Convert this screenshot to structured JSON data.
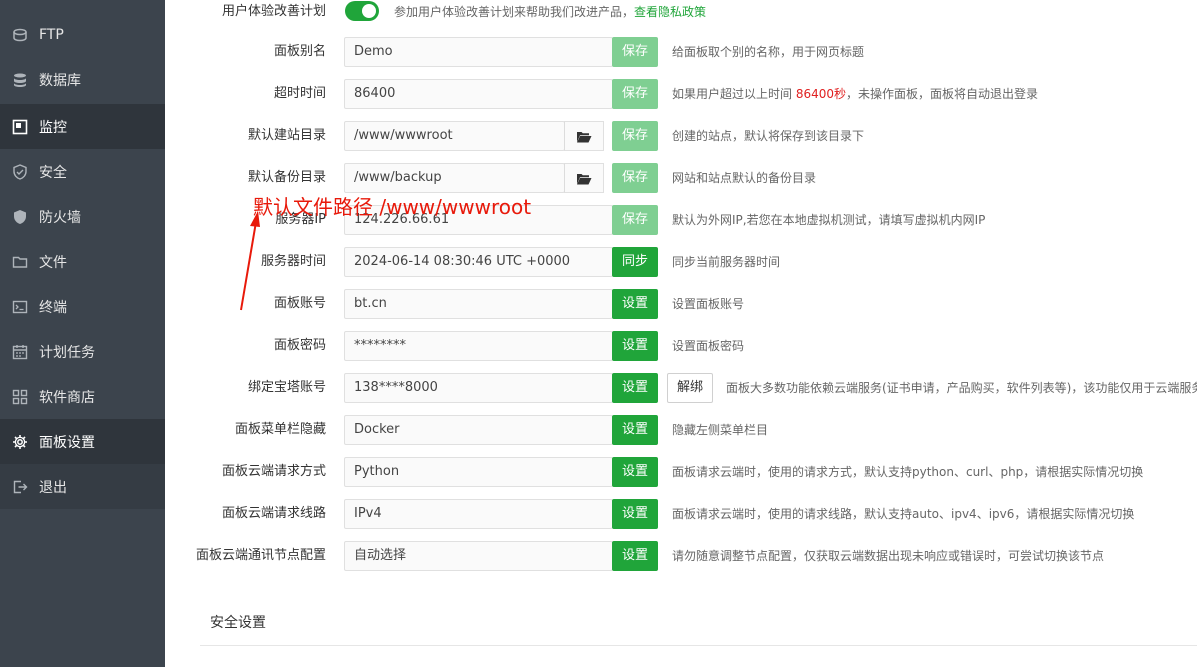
{
  "sidebar": {
    "items": [
      {
        "label": "FTP",
        "icon": "ftp-icon"
      },
      {
        "label": "数据库",
        "icon": "database-icon"
      },
      {
        "label": "监控",
        "icon": "monitor-icon"
      },
      {
        "label": "安全",
        "icon": "shield-check-icon"
      },
      {
        "label": "防火墙",
        "icon": "shield-icon"
      },
      {
        "label": "文件",
        "icon": "folder-icon"
      },
      {
        "label": "终端",
        "icon": "terminal-icon"
      },
      {
        "label": "计划任务",
        "icon": "calendar-icon"
      },
      {
        "label": "软件商店",
        "icon": "grid-icon"
      },
      {
        "label": "面板设置",
        "icon": "gear-icon"
      },
      {
        "label": "退出",
        "icon": "logout-icon"
      }
    ]
  },
  "settings": {
    "ux_plan": {
      "label": "用户体验改善计划",
      "hint": "参加用户体验改善计划来帮助我们改进产品，",
      "link": "查看隐私政策",
      "enabled": true
    },
    "alias": {
      "label": "面板别名",
      "value": "Demo",
      "button": "保存",
      "hint": "给面板取个别的名称，用于网页标题"
    },
    "timeout": {
      "label": "超时时间",
      "value": "86400",
      "button": "保存",
      "hint_before": "如果用户超过以上时间 ",
      "hint_red": "86400秒",
      "hint_after": "，未操作面板，面板将自动退出登录"
    },
    "site_dir": {
      "label": "默认建站目录",
      "value": "/www/wwwroot",
      "button": "保存",
      "hint": "创建的站点，默认将保存到该目录下"
    },
    "backup_dir": {
      "label": "默认备份目录",
      "value": "/www/backup",
      "button": "保存",
      "hint": "网站和站点默认的备份目录"
    },
    "server_ip": {
      "label": "服务器IP",
      "value": "124.226.66.61",
      "button": "保存",
      "hint": "默认为外网IP,若您在本地虚拟机测试，请填写虚拟机内网IP"
    },
    "server_time": {
      "label": "服务器时间",
      "value": "2024-06-14 08:30:46 UTC +0000",
      "button": "同步",
      "hint": "同步当前服务器时间"
    },
    "account": {
      "label": "面板账号",
      "value": "bt.cn",
      "button": "设置",
      "hint": "设置面板账号"
    },
    "password": {
      "label": "面板密码",
      "value": "********",
      "button": "设置",
      "hint": "设置面板密码"
    },
    "bt_account": {
      "label": "绑定宝塔账号",
      "value": "138****8000",
      "button": "设置",
      "button2": "解绑",
      "hint": "面板大多数功能依赖云端服务(证书申请，产品购买，软件列表等)，该功能仅用于云端服务"
    },
    "menu_hide": {
      "label": "面板菜单栏隐藏",
      "value": "Docker",
      "button": "设置",
      "hint": "隐藏左侧菜单栏目"
    },
    "request_method": {
      "label": "面板云端请求方式",
      "value": "Python",
      "button": "设置",
      "hint": "面板请求云端时，使用的请求方式，默认支持python、curl、php，请根据实际情况切换"
    },
    "request_line": {
      "label": "面板云端请求线路",
      "value": "IPv4",
      "button": "设置",
      "hint": "面板请求云端时，使用的请求线路，默认支持auto、ipv4、ipv6，请根据实际情况切换"
    },
    "node_config": {
      "label": "面板云端通讯节点配置",
      "value": "自动选择",
      "button": "设置",
      "hint": "请勿随意调整节点配置，仅获取云端数据出现未响应或错误时，可尝试切换该节点"
    }
  },
  "annotation": {
    "text": "默认文件路径  /www/wwwroot",
    "color": "#e8190a"
  },
  "section": {
    "security_title": "安全设置"
  },
  "colors": {
    "accent": "#20a53a",
    "accent_disabled": "#7fcf92",
    "sidebar_bg": "#3c444d",
    "sidebar_active": "#2f353c"
  }
}
